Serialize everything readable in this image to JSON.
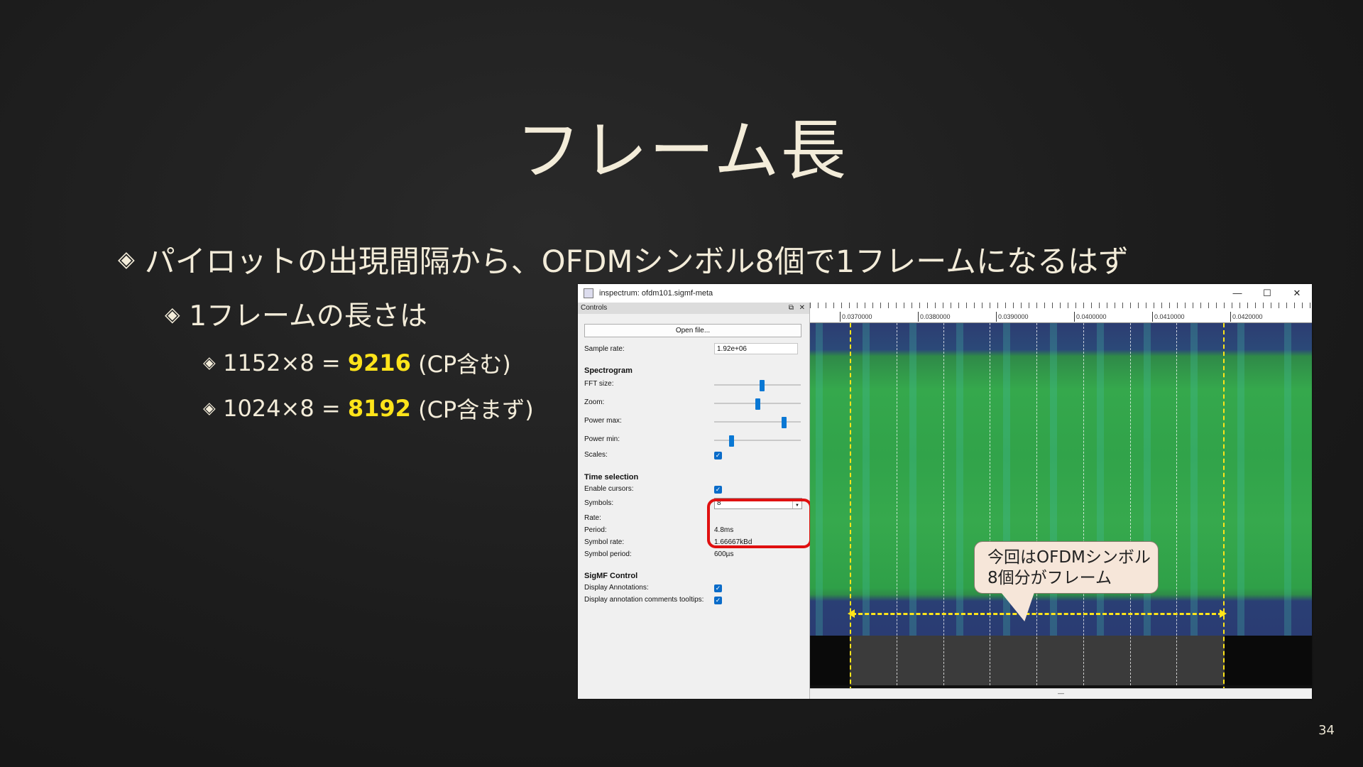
{
  "slide": {
    "title": "フレーム長",
    "bullets": [
      "パイロットの出現間隔から、OFDMシンボル8個で1フレームになるはず",
      "1フレームの長さは"
    ],
    "sub_items": [
      {
        "prefix": "1152×8 = ",
        "value": "9216",
        "suffix": " (CP含む)"
      },
      {
        "prefix": "1024×8 = ",
        "value": "8192",
        "suffix": " (CP含まず)"
      }
    ],
    "page_number": "34",
    "colors": {
      "highlight": "#ffe41a",
      "text": "#f3ecd9",
      "callout_bg": "#f6e6d9",
      "red_box": "#e01010"
    }
  },
  "window": {
    "title": "inspectrum: ofdm101.sigmf-meta",
    "controls_title": "Controls",
    "open_file": "Open file...",
    "sample_rate_label": "Sample rate:",
    "sample_rate_value": "1.92e+06",
    "spectrogram_section": "Spectrogram",
    "fft_size_label": "FFT size:",
    "zoom_label": "Zoom:",
    "power_max_label": "Power max:",
    "power_min_label": "Power min:",
    "scales_label": "Scales:",
    "time_selection_section": "Time selection",
    "enable_cursors_label": "Enable cursors:",
    "symbols_label": "Symbols:",
    "symbols_value": "8",
    "rate_label": "Rate:",
    "period_label": "Period:",
    "period_value": "4.8ms",
    "symbol_rate_label": "Symbol rate:",
    "symbol_rate_value": "1.66667kBd",
    "symbol_period_label": "Symbol period:",
    "symbol_period_value": "600µs",
    "sigmf_section": "SigMF Control",
    "display_annotations_label": "Display Annotations:",
    "display_tooltips_label": "Display annotation comments tooltips:",
    "sliders": {
      "fft_size": 0.55,
      "zoom": 0.5,
      "power_max": 0.8,
      "power_min": 0.2
    },
    "ruler_ticks": [
      "0.0370000",
      "0.0380000",
      "0.0390000",
      "0.0400000",
      "0.0410000",
      "0.0420000"
    ]
  },
  "callout": {
    "line1": "今回はOFDMシンボル",
    "line2": "8個分がフレーム"
  }
}
